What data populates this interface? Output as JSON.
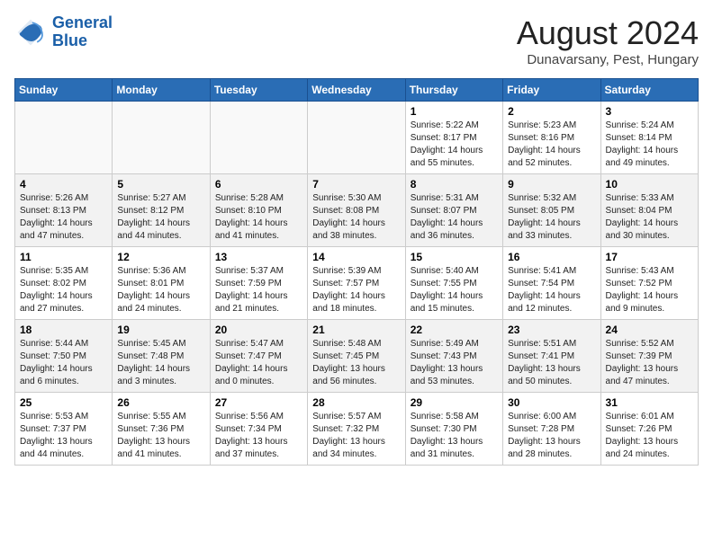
{
  "header": {
    "logo_line1": "General",
    "logo_line2": "Blue",
    "month_title": "August 2024",
    "location": "Dunavarsany, Pest, Hungary"
  },
  "days_of_week": [
    "Sunday",
    "Monday",
    "Tuesday",
    "Wednesday",
    "Thursday",
    "Friday",
    "Saturday"
  ],
  "weeks": [
    [
      {
        "day": "",
        "empty": true
      },
      {
        "day": "",
        "empty": true
      },
      {
        "day": "",
        "empty": true
      },
      {
        "day": "",
        "empty": true
      },
      {
        "day": "1",
        "sunrise": "5:22 AM",
        "sunset": "8:17 PM",
        "daylight": "14 hours and 55 minutes."
      },
      {
        "day": "2",
        "sunrise": "5:23 AM",
        "sunset": "8:16 PM",
        "daylight": "14 hours and 52 minutes."
      },
      {
        "day": "3",
        "sunrise": "5:24 AM",
        "sunset": "8:14 PM",
        "daylight": "14 hours and 49 minutes."
      }
    ],
    [
      {
        "day": "4",
        "sunrise": "5:26 AM",
        "sunset": "8:13 PM",
        "daylight": "14 hours and 47 minutes."
      },
      {
        "day": "5",
        "sunrise": "5:27 AM",
        "sunset": "8:12 PM",
        "daylight": "14 hours and 44 minutes."
      },
      {
        "day": "6",
        "sunrise": "5:28 AM",
        "sunset": "8:10 PM",
        "daylight": "14 hours and 41 minutes."
      },
      {
        "day": "7",
        "sunrise": "5:30 AM",
        "sunset": "8:08 PM",
        "daylight": "14 hours and 38 minutes."
      },
      {
        "day": "8",
        "sunrise": "5:31 AM",
        "sunset": "8:07 PM",
        "daylight": "14 hours and 36 minutes."
      },
      {
        "day": "9",
        "sunrise": "5:32 AM",
        "sunset": "8:05 PM",
        "daylight": "14 hours and 33 minutes."
      },
      {
        "day": "10",
        "sunrise": "5:33 AM",
        "sunset": "8:04 PM",
        "daylight": "14 hours and 30 minutes."
      }
    ],
    [
      {
        "day": "11",
        "sunrise": "5:35 AM",
        "sunset": "8:02 PM",
        "daylight": "14 hours and 27 minutes."
      },
      {
        "day": "12",
        "sunrise": "5:36 AM",
        "sunset": "8:01 PM",
        "daylight": "14 hours and 24 minutes."
      },
      {
        "day": "13",
        "sunrise": "5:37 AM",
        "sunset": "7:59 PM",
        "daylight": "14 hours and 21 minutes."
      },
      {
        "day": "14",
        "sunrise": "5:39 AM",
        "sunset": "7:57 PM",
        "daylight": "14 hours and 18 minutes."
      },
      {
        "day": "15",
        "sunrise": "5:40 AM",
        "sunset": "7:55 PM",
        "daylight": "14 hours and 15 minutes."
      },
      {
        "day": "16",
        "sunrise": "5:41 AM",
        "sunset": "7:54 PM",
        "daylight": "14 hours and 12 minutes."
      },
      {
        "day": "17",
        "sunrise": "5:43 AM",
        "sunset": "7:52 PM",
        "daylight": "14 hours and 9 minutes."
      }
    ],
    [
      {
        "day": "18",
        "sunrise": "5:44 AM",
        "sunset": "7:50 PM",
        "daylight": "14 hours and 6 minutes."
      },
      {
        "day": "19",
        "sunrise": "5:45 AM",
        "sunset": "7:48 PM",
        "daylight": "14 hours and 3 minutes."
      },
      {
        "day": "20",
        "sunrise": "5:47 AM",
        "sunset": "7:47 PM",
        "daylight": "14 hours and 0 minutes."
      },
      {
        "day": "21",
        "sunrise": "5:48 AM",
        "sunset": "7:45 PM",
        "daylight": "13 hours and 56 minutes."
      },
      {
        "day": "22",
        "sunrise": "5:49 AM",
        "sunset": "7:43 PM",
        "daylight": "13 hours and 53 minutes."
      },
      {
        "day": "23",
        "sunrise": "5:51 AM",
        "sunset": "7:41 PM",
        "daylight": "13 hours and 50 minutes."
      },
      {
        "day": "24",
        "sunrise": "5:52 AM",
        "sunset": "7:39 PM",
        "daylight": "13 hours and 47 minutes."
      }
    ],
    [
      {
        "day": "25",
        "sunrise": "5:53 AM",
        "sunset": "7:37 PM",
        "daylight": "13 hours and 44 minutes."
      },
      {
        "day": "26",
        "sunrise": "5:55 AM",
        "sunset": "7:36 PM",
        "daylight": "13 hours and 41 minutes."
      },
      {
        "day": "27",
        "sunrise": "5:56 AM",
        "sunset": "7:34 PM",
        "daylight": "13 hours and 37 minutes."
      },
      {
        "day": "28",
        "sunrise": "5:57 AM",
        "sunset": "7:32 PM",
        "daylight": "13 hours and 34 minutes."
      },
      {
        "day": "29",
        "sunrise": "5:58 AM",
        "sunset": "7:30 PM",
        "daylight": "13 hours and 31 minutes."
      },
      {
        "day": "30",
        "sunrise": "6:00 AM",
        "sunset": "7:28 PM",
        "daylight": "13 hours and 28 minutes."
      },
      {
        "day": "31",
        "sunrise": "6:01 AM",
        "sunset": "7:26 PM",
        "daylight": "13 hours and 24 minutes."
      }
    ]
  ]
}
